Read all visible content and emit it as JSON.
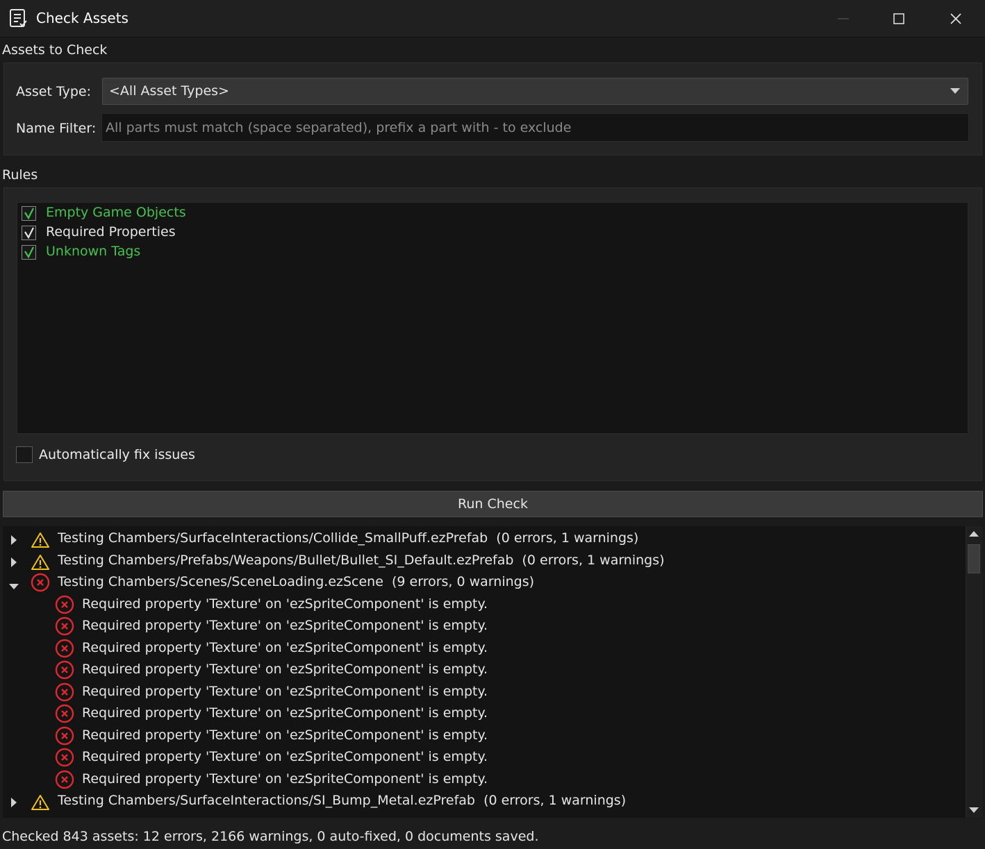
{
  "window": {
    "title": "Check Assets"
  },
  "assets_section": {
    "title": "Assets to Check",
    "asset_type_label": "Asset Type:",
    "asset_type_value": "<All Asset Types>",
    "name_filter_label": "Name Filter:",
    "name_filter_value": "",
    "name_filter_placeholder": "All parts must match (space separated), prefix a part with - to exclude"
  },
  "rules_section": {
    "title": "Rules",
    "rules": [
      {
        "label": "Empty Game Objects",
        "checked": true,
        "color": "#45c24f"
      },
      {
        "label": "Required Properties",
        "checked": true,
        "color": "#e6e6e6"
      },
      {
        "label": "Unknown Tags",
        "checked": true,
        "color": "#45c24f"
      }
    ],
    "auto_fix_label": "Automatically fix issues",
    "auto_fix_checked": false
  },
  "run_button_label": "Run Check",
  "results": [
    {
      "type": "warning",
      "expanded": false,
      "level": 0,
      "text": "Testing Chambers/SurfaceInteractions/Collide_SmallPuff.ezPrefab  (0 errors, 1 warnings)"
    },
    {
      "type": "warning",
      "expanded": false,
      "level": 0,
      "text": "Testing Chambers/Prefabs/Weapons/Bullet/Bullet_SI_Default.ezPrefab  (0 errors, 1 warnings)"
    },
    {
      "type": "error",
      "expanded": true,
      "level": 0,
      "text": "Testing Chambers/Scenes/SceneLoading.ezScene  (9 errors, 0 warnings)"
    },
    {
      "type": "error",
      "level": 1,
      "text": "Required property 'Texture' on 'ezSpriteComponent' is empty."
    },
    {
      "type": "error",
      "level": 1,
      "text": "Required property 'Texture' on 'ezSpriteComponent' is empty."
    },
    {
      "type": "error",
      "level": 1,
      "text": "Required property 'Texture' on 'ezSpriteComponent' is empty."
    },
    {
      "type": "error",
      "level": 1,
      "text": "Required property 'Texture' on 'ezSpriteComponent' is empty."
    },
    {
      "type": "error",
      "level": 1,
      "text": "Required property 'Texture' on 'ezSpriteComponent' is empty."
    },
    {
      "type": "error",
      "level": 1,
      "text": "Required property 'Texture' on 'ezSpriteComponent' is empty."
    },
    {
      "type": "error",
      "level": 1,
      "text": "Required property 'Texture' on 'ezSpriteComponent' is empty."
    },
    {
      "type": "error",
      "level": 1,
      "text": "Required property 'Texture' on 'ezSpriteComponent' is empty."
    },
    {
      "type": "error",
      "level": 1,
      "text": "Required property 'Texture' on 'ezSpriteComponent' is empty."
    },
    {
      "type": "warning",
      "expanded": false,
      "level": 0,
      "text": "Testing Chambers/SurfaceInteractions/SI_Bump_Metal.ezPrefab  (0 errors, 1 warnings)"
    }
  ],
  "status": "Checked 843 assets: 12 errors, 2166 warnings, 0 auto-fixed, 0 documents saved.",
  "colors": {
    "error": "#e0282f",
    "warning": "#f2c21b",
    "accent_green": "#45c24f"
  }
}
